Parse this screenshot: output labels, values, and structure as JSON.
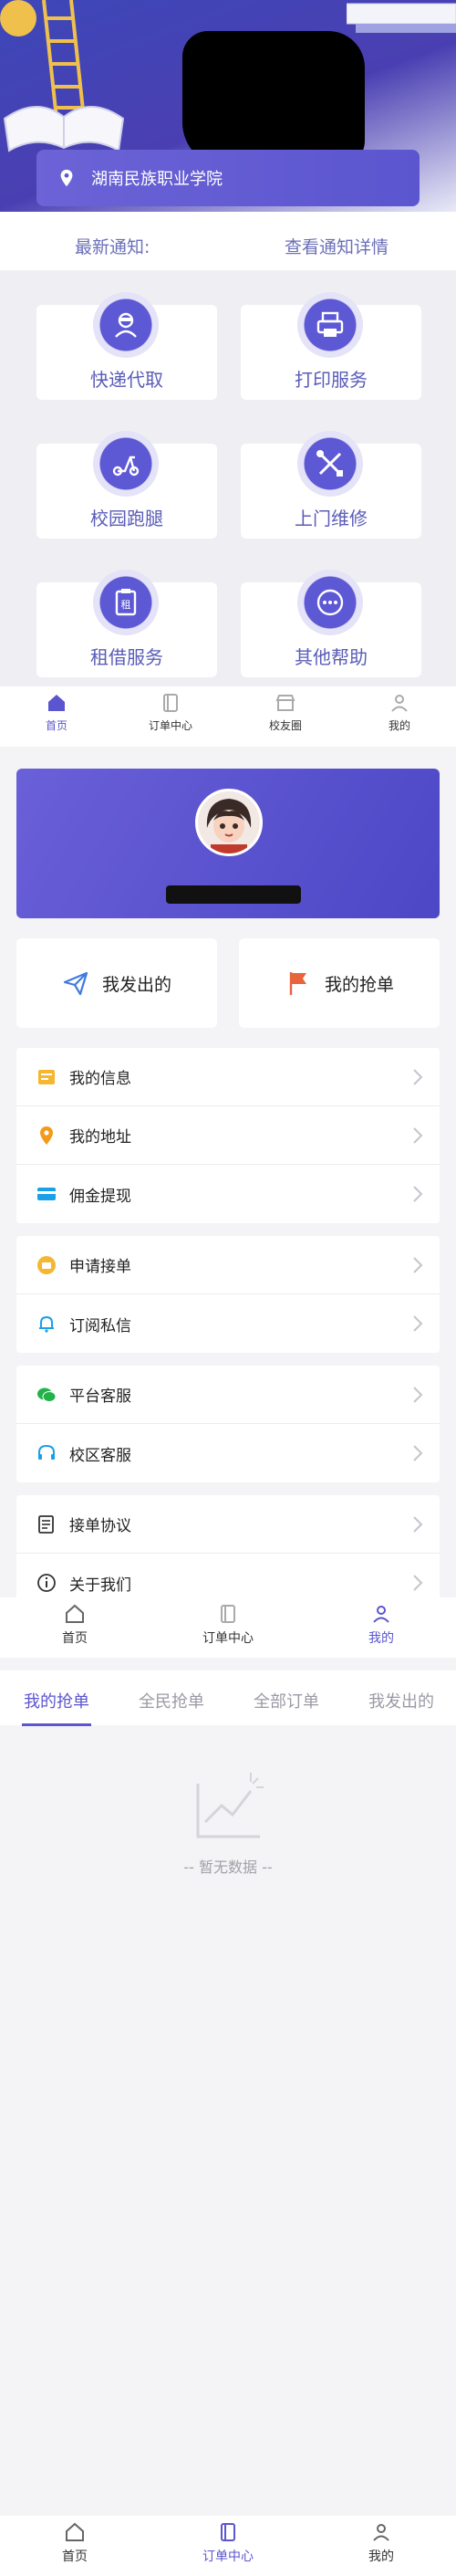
{
  "home": {
    "location": "湖南民族职业学院",
    "notice_label": "最新通知:",
    "notice_more": "查看通知详情",
    "services": [
      {
        "label": "快递代取",
        "icon": "delivery-person-icon"
      },
      {
        "label": "打印服务",
        "icon": "printer-icon"
      },
      {
        "label": "校园跑腿",
        "icon": "scooter-icon"
      },
      {
        "label": "上门维修",
        "icon": "tools-icon"
      },
      {
        "label": "租借服务",
        "icon": "rent-clipboard-icon"
      },
      {
        "label": "其他帮助",
        "icon": "more-dots-icon"
      }
    ]
  },
  "tabbar_home": {
    "items": [
      {
        "label": "首页",
        "icon": "home-icon"
      },
      {
        "label": "订单中心",
        "icon": "order-book-icon"
      },
      {
        "label": "校友圈",
        "icon": "store-icon"
      },
      {
        "label": "我的",
        "icon": "user-icon"
      }
    ]
  },
  "me": {
    "quick": [
      {
        "label": "我发出的",
        "icon": "send-plane-icon"
      },
      {
        "label": "我的抢单",
        "icon": "flag-icon"
      }
    ],
    "group1": [
      "我的信息",
      "我的地址",
      "佣金提现"
    ],
    "group2": [
      "申请接单",
      "订阅私信"
    ],
    "group3": [
      "平台客服",
      "校区客服"
    ],
    "group4": [
      "接单协议",
      "关于我们"
    ]
  },
  "tabbar_me": {
    "items": [
      {
        "label": "首页",
        "icon": "home-icon"
      },
      {
        "label": "订单中心",
        "icon": "order-book-icon"
      },
      {
        "label": "我的",
        "icon": "user-icon"
      }
    ]
  },
  "orders": {
    "tabs": [
      "我的抢单",
      "全民抢单",
      "全部订单",
      "我发出的"
    ],
    "empty_text": "-- 暂无数据 --"
  },
  "tabbar_orders": {
    "items": [
      {
        "label": "首页",
        "icon": "home-icon"
      },
      {
        "label": "订单中心",
        "icon": "order-book-icon"
      },
      {
        "label": "我的",
        "icon": "user-icon"
      }
    ]
  },
  "colors": {
    "accent": "#5b55cf",
    "label_blue": "#5a5cb8"
  }
}
